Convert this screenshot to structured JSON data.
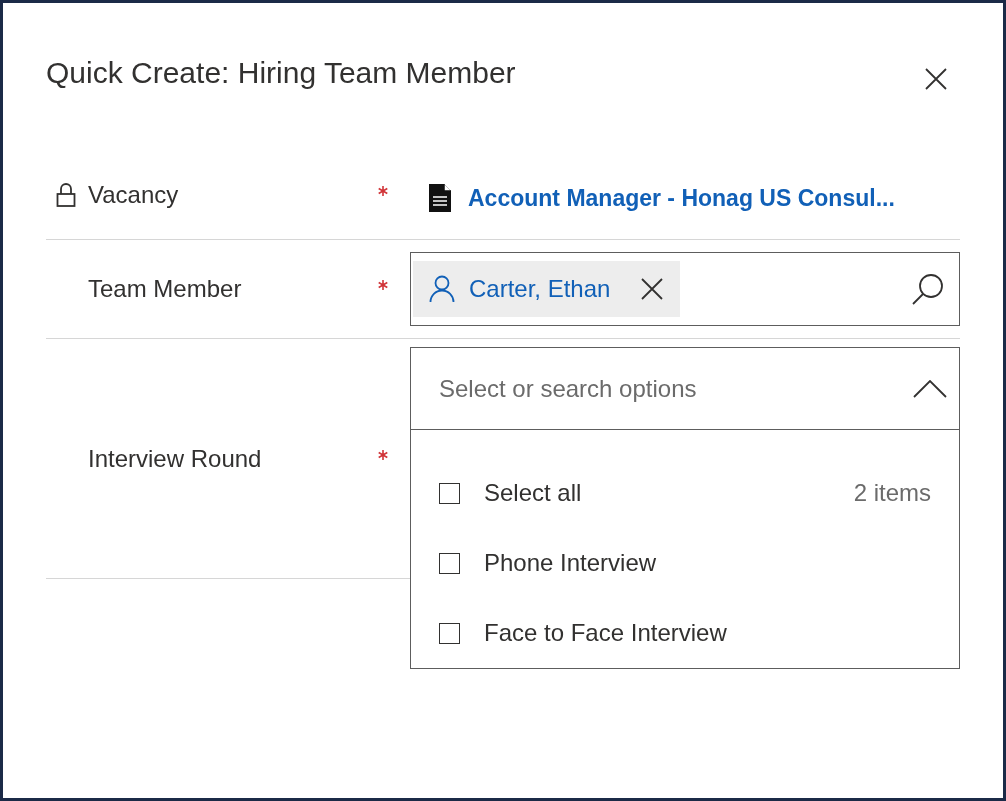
{
  "dialog": {
    "title": "Quick Create: Hiring Team Member"
  },
  "fields": [
    {
      "kind": "readonly-lookup",
      "label": "Vacancy",
      "locked": true,
      "required": true,
      "value": "Account Manager - Honag US Consul..."
    },
    {
      "kind": "lookup",
      "label": "Team Member",
      "locked": false,
      "required": true,
      "tag": "Carter, Ethan"
    },
    {
      "kind": "multiselect",
      "label": "Interview Round",
      "locked": false,
      "required": true,
      "placeholder": "Select or search options",
      "expanded": true,
      "select_all": {
        "label": "Select all",
        "checked": false
      },
      "count": "2 items",
      "options": [
        {
          "label": "Phone Interview",
          "checked": false
        },
        {
          "label": "Face to Face Interview",
          "checked": false
        }
      ]
    }
  ]
}
